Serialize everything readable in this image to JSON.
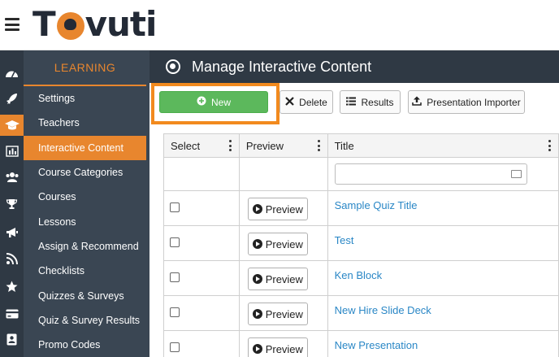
{
  "brand": {
    "logo_first": "T",
    "logo_rest": "vuti"
  },
  "sidebar": {
    "heading": "LEARNING",
    "items": [
      {
        "label": "Settings"
      },
      {
        "label": "Teachers"
      },
      {
        "label": "Interactive Content",
        "active": true
      },
      {
        "label": "Course Categories"
      },
      {
        "label": "Courses"
      },
      {
        "label": "Lessons"
      },
      {
        "label": "Assign & Recommend"
      },
      {
        "label": "Checklists"
      },
      {
        "label": "Quizzes & Surveys"
      },
      {
        "label": "Quiz & Survey Results"
      },
      {
        "label": "Promo Codes"
      }
    ]
  },
  "rail_icons": [
    "dashboard-icon",
    "rocket-icon",
    "graduation-cap-icon",
    "bar-chart-icon",
    "users-icon",
    "trophy-icon",
    "megaphone-icon",
    "feed-icon",
    "star-icon",
    "credit-card-icon",
    "id-badge-icon"
  ],
  "page": {
    "title": "Manage Interactive Content"
  },
  "toolbar": {
    "new_label": "New",
    "delete_label": "Delete",
    "results_label": "Results",
    "importer_label": "Presentation Importer"
  },
  "table": {
    "columns": [
      "Select",
      "Preview",
      "Title"
    ],
    "filter_placeholder": "",
    "preview_label": "Preview",
    "rows": [
      {
        "title": "Sample Quiz Title"
      },
      {
        "title": "Test"
      },
      {
        "title": "Ken Block"
      },
      {
        "title": "New Hire Slide Deck"
      },
      {
        "title": "New Presentation"
      }
    ]
  },
  "colors": {
    "accent": "#e8862e",
    "sidebar": "#3a4653",
    "rail": "#2f3944",
    "new_button": "#5cb85c",
    "link": "#2a87c6"
  }
}
